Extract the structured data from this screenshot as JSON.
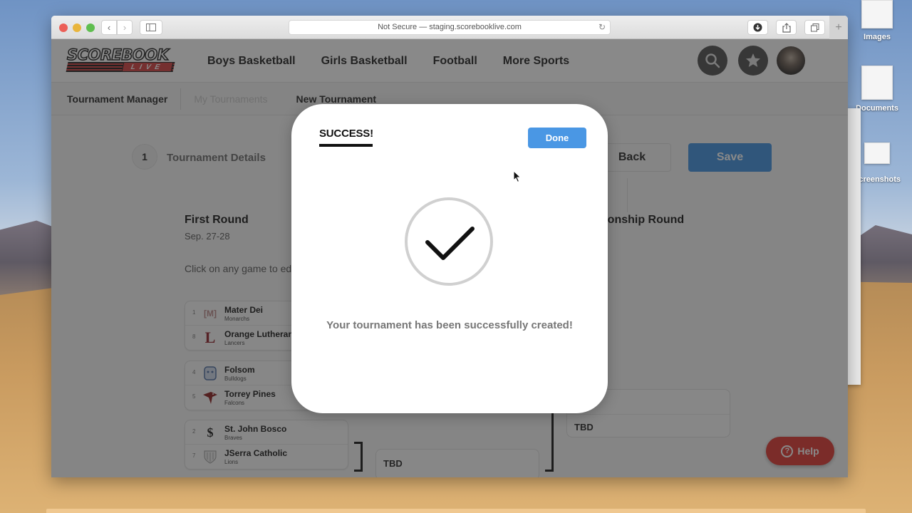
{
  "desktop": {
    "icons": [
      {
        "label": "Images"
      },
      {
        "label": "Documents"
      },
      {
        "label": "Screenshots"
      }
    ]
  },
  "browser": {
    "address": "Not Secure — staging.scorebooklive.com",
    "icons": {
      "back": "chevron-left",
      "forward": "chevron-right",
      "sidebar": "sidebar",
      "reload": "reload",
      "downloads": "download",
      "share": "share",
      "tabs": "tabs",
      "new_tab": "+"
    }
  },
  "site": {
    "logo_top": "SCOREBOOK",
    "logo_bottom": "LIVE",
    "nav": [
      "Boys Basketball",
      "Girls Basketball",
      "Football",
      "More Sports"
    ],
    "subnav": {
      "section": "Tournament Manager",
      "my_tournaments": "My Tournaments",
      "new_tournament": "New Tournament"
    }
  },
  "wizard": {
    "step_number": "1",
    "step_label": "Tournament Details",
    "back_label": "Back",
    "save_label": "Save"
  },
  "bracket": {
    "first_round": {
      "title": "First Round",
      "date": "Sep. 27-28"
    },
    "championship_round": {
      "title": "Championship Round"
    },
    "instructions": "Click on any game to edit",
    "games": [
      {
        "teams": [
          {
            "seed": "1",
            "name": "Mater Dei",
            "mascot": "Monarchs"
          },
          {
            "seed": "8",
            "name": "Orange Lutheran",
            "mascot": "Lancers"
          }
        ]
      },
      {
        "teams": [
          {
            "seed": "4",
            "name": "Folsom",
            "mascot": "Bulldogs"
          },
          {
            "seed": "5",
            "name": "Torrey Pines",
            "mascot": "Falcons"
          }
        ]
      },
      {
        "teams": [
          {
            "seed": "2",
            "name": "St. John Bosco",
            "mascot": "Braves"
          },
          {
            "seed": "7",
            "name": "JSerra Catholic",
            "mascot": "Lions"
          }
        ]
      }
    ],
    "tbd": [
      "TBD",
      "TBD"
    ]
  },
  "help": {
    "label": "Help"
  },
  "modal": {
    "title": "SUCCESS!",
    "done_label": "Done",
    "message": "Your tournament has been successfully created!"
  },
  "colors": {
    "primary_blue": "#4a97e4",
    "help_red": "#e0312b",
    "brand_red": "#d23b3b"
  }
}
